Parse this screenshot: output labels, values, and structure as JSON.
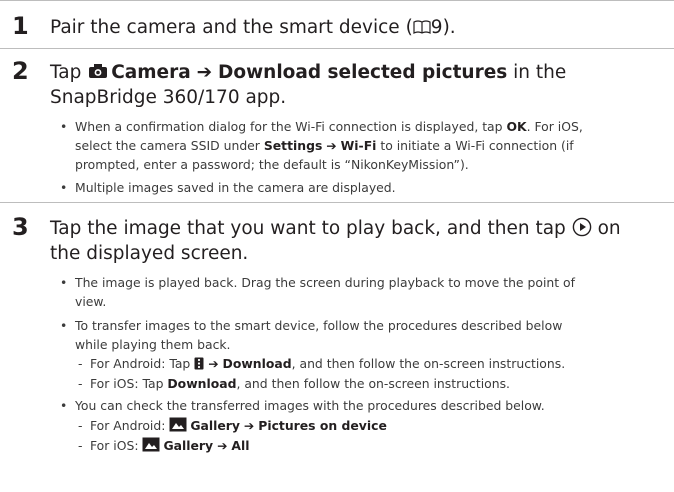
{
  "steps": [
    {
      "number": "1",
      "heading": "Pair the camera and the smart device (",
      "heading_ref": "9",
      "heading_end": ")."
    },
    {
      "number": "2",
      "heading_pre": "Tap ",
      "camera_label": "Camera",
      "arrow": "➔",
      "download_label": "Download selected pictures",
      "heading_post_1": " in the",
      "heading_line2": "SnapBridge 360/170 app.",
      "bullets": [
        {
          "t1": "When a confirmation dialog for the Wi-Fi connection is displayed, tap ",
          "ok": "OK",
          "t2": ". For iOS,",
          "l2a": "select the camera SSID under ",
          "settings": "Settings",
          "wifi": "Wi-Fi",
          "l2b": " to initiate a Wi-Fi connection (if",
          "l3": "prompted, enter a password; the default is “NikonKeyMission”)."
        },
        {
          "text": "Multiple images saved in the camera are displayed."
        }
      ]
    },
    {
      "number": "3",
      "heading_line1": "Tap the image that you want to play back, and then tap ",
      "heading_line1_end": " on",
      "heading_line2": "the displayed screen.",
      "bullets": [
        {
          "l1": "The image is played back. Drag the screen during playback to move the point of",
          "l2": "view."
        },
        {
          "l1": "To transfer images to the smart device, follow the procedures described below",
          "l2": "while playing them back.",
          "subs": [
            {
              "pre": "For Android: Tap ",
              "bold": "Download",
              "post": ", and then follow the on-screen instructions."
            },
            {
              "pre": "For iOS: Tap ",
              "bold": "Download",
              "post": ", and then follow the on-screen instructions."
            }
          ]
        },
        {
          "l1": "You can check the transferred images with the procedures described below.",
          "subs": [
            {
              "pre": "For Android: ",
              "gallery": "Gallery",
              "dest": "Pictures on device"
            },
            {
              "pre": "For iOS: ",
              "gallery": "Gallery",
              "dest": "All"
            }
          ]
        }
      ]
    }
  ],
  "icons": {
    "book": "book-reference-icon",
    "camera": "camera-tab-icon",
    "play": "play-circle-icon",
    "menu": "vertical-menu-icon",
    "gallery": "gallery-icon"
  }
}
